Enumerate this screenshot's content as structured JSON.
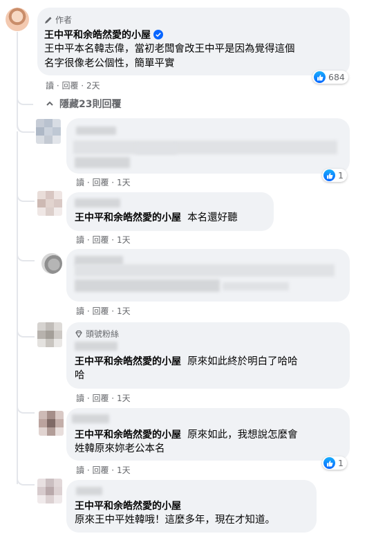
{
  "author_comment": {
    "badge": "作者",
    "name": "王中平和余皓然愛的小屋",
    "text_line1": "王中平本名韓志偉，當初老闆會改王中平是因為覺得這個",
    "text_line2": "名字很像老公個性，簡單平實",
    "likes": "684",
    "action_read": "讀",
    "action_reply": "回覆",
    "time": "2天"
  },
  "hide_replies": {
    "label": "隱藏23則回覆"
  },
  "replies": [
    {
      "action_read": "讀",
      "action_reply": "回覆",
      "time": "1天",
      "likes": "1"
    },
    {
      "tag": "王中平和余皓然愛的小屋",
      "text": "本名還好聽",
      "action_read": "讀",
      "action_reply": "回覆",
      "time": "1天"
    },
    {
      "action_read": "讀",
      "action_reply": "回覆",
      "time": "1天"
    },
    {
      "badge": "頭號粉絲",
      "tag": "王中平和余皓然愛的小屋",
      "text_line1": "原來如此終於明白了哈哈",
      "text_line2": "哈",
      "action_read": "讀",
      "action_reply": "回覆",
      "time": "1天"
    },
    {
      "tag": "王中平和余皓然愛的小屋",
      "text_line1": "原來如此，我想說怎麼會",
      "text_line2": "姓韓原來妳老公本名",
      "action_read": "讀",
      "action_reply": "回覆",
      "time": "1天",
      "likes": "1"
    },
    {
      "tag": "王中平和余皓然愛的小屋",
      "text_line2": "原來王中平姓韓哦！這麼多年，現在才知道。"
    }
  ],
  "colors": {
    "accent": "#0866ff",
    "bubble": "#f0f2f5",
    "meta": "#65676b"
  }
}
